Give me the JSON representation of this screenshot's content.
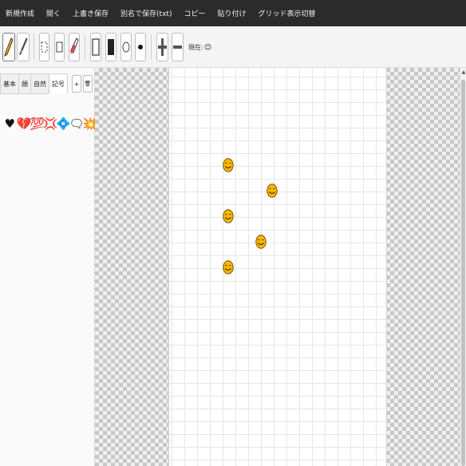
{
  "menu": {
    "items": [
      "新規作成",
      "開く",
      "上書き保存",
      "別名で保存(txt)",
      "コピー",
      "貼り付け",
      "グリッド表示切替"
    ]
  },
  "toolbar": {
    "tools": [
      "pencil-icon",
      "brush-icon",
      "select-icon",
      "rect-outline-icon",
      "eraser-icon",
      "rect-outline-icon",
      "rect-fill-icon",
      "circle-outline-icon",
      "dot-icon",
      "grid-plus-icon",
      "grid-minus-icon"
    ],
    "char_label": "現在:",
    "current_char": "😊"
  },
  "sidebar": {
    "tabs": [
      "基本",
      "顔",
      "自然",
      "記号"
    ],
    "active_tab": "記号",
    "add_label": "+",
    "delete_label": "🗑",
    "palette": [
      "♥",
      "💔",
      "💯",
      "💢",
      "💠",
      "🗨",
      "💥"
    ]
  },
  "canvas": {
    "emoji": "😊",
    "placed_count": 5
  },
  "colors": {
    "menubar": "#2b2b2b",
    "toolbar": "#f4f4f4",
    "checker": "#c8c8c8",
    "grid": "#e6e6e6",
    "emoji_face": "#f5b800"
  }
}
